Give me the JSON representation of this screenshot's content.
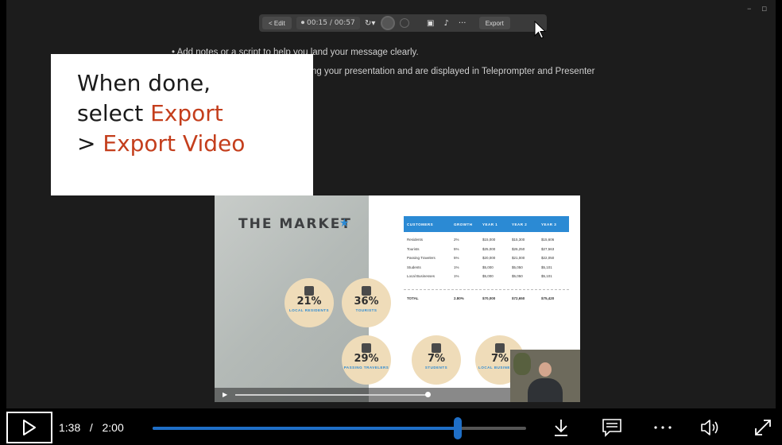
{
  "toolbar": {
    "edit_label": "< Edit",
    "timer": "⏺ 00:15 / 00:57",
    "retake_icon": "retake-icon",
    "more_label": "···",
    "export_label": "Export"
  },
  "notes": {
    "line1": "• Add notes or a script to help you land your message clearly.",
    "line2_fragment": "ng your presentation and are displayed in Teleprompter and Presenter"
  },
  "callout": {
    "line1": "When done,",
    "line2_prefix": "select ",
    "line2_accent": "Export",
    "line3_prefix": "> ",
    "line3_accent": "Export Video",
    "accent_color": "#c43e1c"
  },
  "slide": {
    "title": "THE MARKET",
    "star": "★",
    "stats": [
      {
        "pct": "21%",
        "label": "LOCAL RESIDENTS"
      },
      {
        "pct": "36%",
        "label": "TOURISTS"
      },
      {
        "pct": "29%",
        "label": "PASSING TRAVELERS"
      },
      {
        "pct": "7%",
        "label": "STUDENTS"
      },
      {
        "pct": "7%",
        "label": "LOCAL BUSINESSES"
      }
    ],
    "table": {
      "headers": [
        "CUSTOMERS",
        "GROWTH",
        "YEAR 1",
        "YEAR 2",
        "YEAR 3"
      ],
      "rows": [
        [
          "Residents",
          "2%",
          "$15,000",
          "$15,300",
          "$15,606"
        ],
        [
          "Tourists",
          "5%",
          "$25,000",
          "$26,250",
          "$27,563"
        ],
        [
          "Passing Travelers",
          "5%",
          "$20,000",
          "$21,000",
          "$22,050"
        ],
        [
          "Students",
          "1%",
          "$5,000",
          "$5,050",
          "$5,101"
        ],
        [
          "Local Businesses",
          "1%",
          "$5,000",
          "$5,050",
          "$5,101"
        ]
      ],
      "total": [
        "TOTAL",
        "2.80%",
        "$70,000",
        "$72,650",
        "$75,420"
      ]
    }
  },
  "player": {
    "current_time": "1:38",
    "separator": "/",
    "duration": "2:00",
    "progress_fraction": 0.817,
    "accent_color": "#1f6fc7"
  }
}
